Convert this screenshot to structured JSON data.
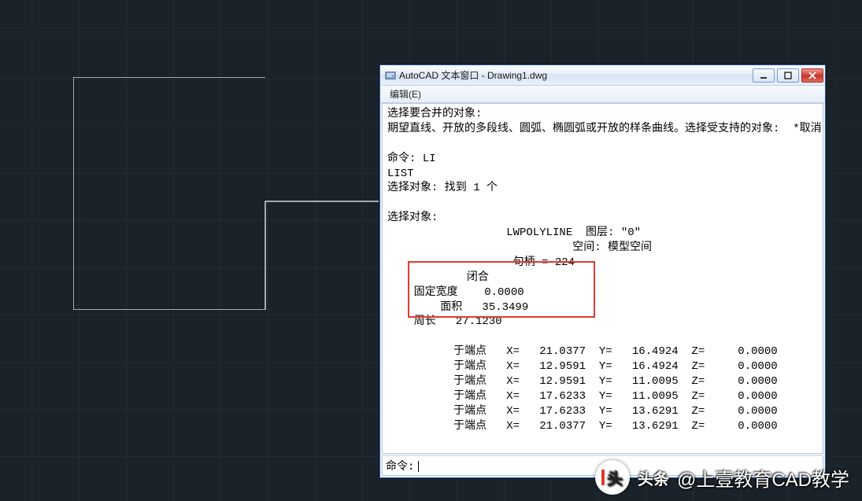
{
  "window": {
    "title": "AutoCAD 文本窗口 - Drawing1.dwg"
  },
  "menubar": {
    "edit": "编辑(E)"
  },
  "console": {
    "line_select_merge": "选择要合并的对象:",
    "line_expect": "期望直线、开放的多段线、圆弧、椭圆弧或开放的样条曲线。选择受支持的对象:  *取消",
    "cmd_label": "命令: ",
    "cmd_li": "LI",
    "cmd_list": "LIST",
    "select_found": "选择对象: 找到 1 个",
    "select_obj": "选择对象:",
    "lw_line": "                  LWPOLYLINE  图层: \"0\"",
    "space_line": "                            空间: 模型空间",
    "handle_line": "                   句柄 = 224",
    "closed": "            闭合",
    "fixed_width": "    固定宽度    0.0000",
    "area": "        面积   35.3499",
    "perimeter": "    周长   27.1230",
    "vertex_prefix": "          于端点",
    "vertices": [
      {
        "x": "21.0377",
        "y": "16.4924",
        "z": "0.0000"
      },
      {
        "x": "12.9591",
        "y": "16.4924",
        "z": "0.0000"
      },
      {
        "x": "12.9591",
        "y": "11.0095",
        "z": "0.0000"
      },
      {
        "x": "17.6233",
        "y": "11.0095",
        "z": "0.0000"
      },
      {
        "x": "17.6233",
        "y": "13.6291",
        "z": "0.0000"
      },
      {
        "x": "21.0377",
        "y": "13.6291",
        "z": "0.0000"
      }
    ]
  },
  "cmdline": {
    "prompt": "命令:"
  },
  "watermark": {
    "brand": "头条",
    "author": "@上壹教育CAD教学"
  }
}
